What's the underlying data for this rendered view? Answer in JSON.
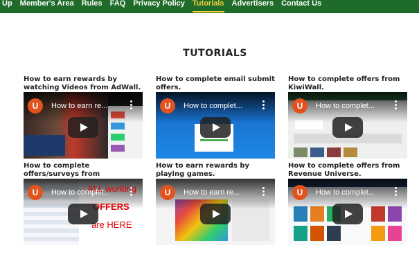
{
  "nav": {
    "items": [
      {
        "label": "Up"
      },
      {
        "label": "Member's Area"
      },
      {
        "label": "Rules"
      },
      {
        "label": "FAQ"
      },
      {
        "label": "Privacy Policy"
      },
      {
        "label": "Tutorials",
        "active": true
      },
      {
        "label": "Advertisers"
      },
      {
        "label": "Contact Us"
      }
    ],
    "bg_color": "#1f6b2a",
    "active_color": "#f4d03f"
  },
  "page": {
    "title": "TUTORIALS"
  },
  "tutorials": [
    {
      "title": "How to earn rewards by watching Videos from AdWall.",
      "video_title": "How to earn re...",
      "avatar": "U"
    },
    {
      "title": "How to complete email submit offers.",
      "video_title": "How to complet...",
      "avatar": "U"
    },
    {
      "title": "How to complete offers from KiwiWall.",
      "video_title": "How to complet...",
      "avatar": "U"
    },
    {
      "title": "How to complete offers/surveys from offerwalls.",
      "video_title": "How to complet...",
      "avatar": "U",
      "overlay_text": [
        "ALL working",
        "OFFERS",
        "are HERE"
      ]
    },
    {
      "title": "How to earn rewards by playing games.",
      "video_title": "How to earn re...",
      "avatar": "U"
    },
    {
      "title": "How to complete offers from Revenue Universe.",
      "video_title": "How to complet...",
      "avatar": "U"
    }
  ],
  "icons": {
    "play": "play-icon",
    "menu": "more-vert-icon",
    "avatar": "channel-avatar"
  }
}
